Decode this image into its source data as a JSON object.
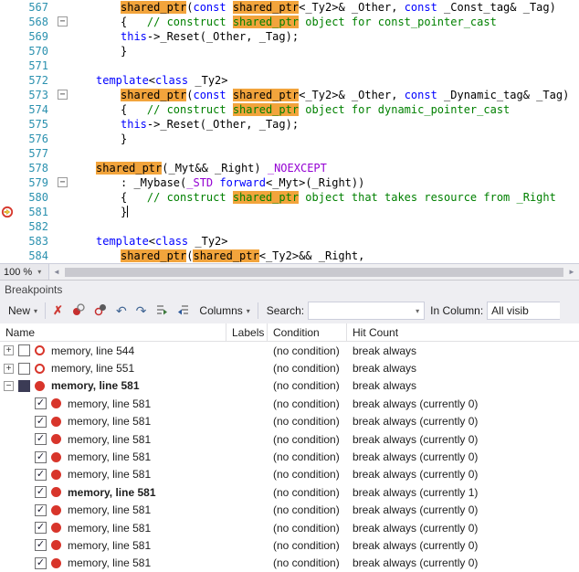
{
  "editor": {
    "zoom_label": "100 %",
    "lines": [
      {
        "num": 567,
        "ind": 2,
        "seg": [
          [
            "hl",
            "shared_ptr"
          ],
          [
            "p",
            "("
          ],
          [
            "k",
            "const"
          ],
          [
            "p",
            " "
          ],
          [
            "hl",
            "shared_ptr"
          ],
          [
            "p",
            "<_Ty2>& _Other, "
          ],
          [
            "k",
            "const"
          ],
          [
            "p",
            " _Const_tag& _Tag)"
          ]
        ]
      },
      {
        "num": 568,
        "ind": 2,
        "fold": true,
        "seg": [
          [
            "p",
            "{   "
          ],
          [
            "cm",
            "// construct "
          ],
          [
            "hlc",
            "shared_ptr"
          ],
          [
            "cm",
            " object for const_pointer_cast"
          ]
        ]
      },
      {
        "num": 569,
        "ind": 2,
        "seg": [
          [
            "k",
            "this"
          ],
          [
            "p",
            "->_Reset(_Other, _Tag);"
          ]
        ]
      },
      {
        "num": 570,
        "ind": 2,
        "seg": [
          [
            "p",
            "}"
          ]
        ]
      },
      {
        "num": 571,
        "ind": 0,
        "seg": []
      },
      {
        "num": 572,
        "ind": 1,
        "seg": [
          [
            "k",
            "template"
          ],
          [
            "p",
            "<"
          ],
          [
            "k",
            "class"
          ],
          [
            "p",
            " _Ty2>"
          ]
        ]
      },
      {
        "num": 573,
        "ind": 2,
        "fold": true,
        "seg": [
          [
            "hl",
            "shared_ptr"
          ],
          [
            "p",
            "("
          ],
          [
            "k",
            "const"
          ],
          [
            "p",
            " "
          ],
          [
            "hl",
            "shared_ptr"
          ],
          [
            "p",
            "<_Ty2>& _Other, "
          ],
          [
            "k",
            "const"
          ],
          [
            "p",
            " _Dynamic_tag& _Tag)"
          ]
        ]
      },
      {
        "num": 574,
        "ind": 2,
        "seg": [
          [
            "p",
            "{   "
          ],
          [
            "cm",
            "// construct "
          ],
          [
            "hlc",
            "shared_ptr"
          ],
          [
            "cm",
            " object for dynamic_pointer_cast"
          ]
        ]
      },
      {
        "num": 575,
        "ind": 2,
        "seg": [
          [
            "k",
            "this"
          ],
          [
            "p",
            "->_Reset(_Other, _Tag);"
          ]
        ]
      },
      {
        "num": 576,
        "ind": 2,
        "seg": [
          [
            "p",
            "}"
          ]
        ]
      },
      {
        "num": 577,
        "ind": 0,
        "seg": []
      },
      {
        "num": 578,
        "ind": 1,
        "seg": [
          [
            "hl",
            "shared_ptr"
          ],
          [
            "p",
            "(_Myt&& _Right) "
          ],
          [
            "m",
            "_NOEXCEPT"
          ]
        ]
      },
      {
        "num": 579,
        "ind": 2,
        "fold": true,
        "seg": [
          [
            "p",
            ": _Mybase("
          ],
          [
            "m",
            "_STD"
          ],
          [
            "p",
            " "
          ],
          [
            "k",
            "forward"
          ],
          [
            "p",
            "<_Myt>(_Right))"
          ]
        ]
      },
      {
        "num": 580,
        "ind": 2,
        "seg": [
          [
            "p",
            "{   "
          ],
          [
            "cm",
            "// construct "
          ],
          [
            "hlc",
            "shared_ptr"
          ],
          [
            "cm",
            " object that takes resource from _Right"
          ]
        ]
      },
      {
        "num": 581,
        "ind": 2,
        "glyph": "breakpoint-hit",
        "caret": true,
        "seg": [
          [
            "p",
            "}"
          ]
        ]
      },
      {
        "num": 582,
        "ind": 0,
        "seg": []
      },
      {
        "num": 583,
        "ind": 1,
        "seg": [
          [
            "k",
            "template"
          ],
          [
            "p",
            "<"
          ],
          [
            "k",
            "class"
          ],
          [
            "p",
            " _Ty2>"
          ]
        ]
      },
      {
        "num": 584,
        "ind": 2,
        "seg": [
          [
            "hl",
            "shared_ptr"
          ],
          [
            "p",
            "("
          ],
          [
            "hl",
            "shared_ptr"
          ],
          [
            "p",
            "<_Ty2>&& _Right,"
          ]
        ]
      }
    ]
  },
  "panel": {
    "title": "Breakpoints",
    "toolbar": {
      "new_label": "New",
      "columns_label": "Columns",
      "search_label": "Search:",
      "search_value": "",
      "in_column_label": "In Column:",
      "in_column_value": "All visib"
    },
    "columns": [
      "Name",
      "Labels",
      "Condition",
      "Hit Count"
    ],
    "rows": [
      {
        "lvl": 0,
        "exp": "plus",
        "chk": "off",
        "bp": "hollow",
        "bold": false,
        "name": "memory, line 544",
        "labels": "",
        "cond": "(no condition)",
        "hit": "break always"
      },
      {
        "lvl": 0,
        "exp": "plus",
        "chk": "off",
        "bp": "hollow",
        "bold": false,
        "name": "memory, line 551",
        "labels": "",
        "cond": "(no condition)",
        "hit": "break always"
      },
      {
        "lvl": 0,
        "exp": "minus",
        "chk": "filled",
        "bp": "solid",
        "bold": true,
        "name": "memory, line 581",
        "labels": "",
        "cond": "(no condition)",
        "hit": "break always"
      },
      {
        "lvl": 1,
        "chk": "check",
        "bp": "solid",
        "bold": false,
        "name": "memory, line 581",
        "labels": "",
        "cond": "(no condition)",
        "hit": "break always (currently 0)"
      },
      {
        "lvl": 1,
        "chk": "check",
        "bp": "solid",
        "bold": false,
        "name": "memory, line 581",
        "labels": "",
        "cond": "(no condition)",
        "hit": "break always (currently 0)"
      },
      {
        "lvl": 1,
        "chk": "check",
        "bp": "solid",
        "bold": false,
        "name": "memory, line 581",
        "labels": "",
        "cond": "(no condition)",
        "hit": "break always (currently 0)"
      },
      {
        "lvl": 1,
        "chk": "check",
        "bp": "solid",
        "bold": false,
        "name": "memory, line 581",
        "labels": "",
        "cond": "(no condition)",
        "hit": "break always (currently 0)"
      },
      {
        "lvl": 1,
        "chk": "check",
        "bp": "solid",
        "bold": false,
        "name": "memory, line 581",
        "labels": "",
        "cond": "(no condition)",
        "hit": "break always (currently 0)"
      },
      {
        "lvl": 1,
        "chk": "check",
        "bp": "solid",
        "bold": true,
        "name": "memory, line 581",
        "labels": "",
        "cond": "(no condition)",
        "hit": "break always (currently 1)"
      },
      {
        "lvl": 1,
        "chk": "check",
        "bp": "solid",
        "bold": false,
        "name": "memory, line 581",
        "labels": "",
        "cond": "(no condition)",
        "hit": "break always (currently 0)"
      },
      {
        "lvl": 1,
        "chk": "check",
        "bp": "solid",
        "bold": false,
        "name": "memory, line 581",
        "labels": "",
        "cond": "(no condition)",
        "hit": "break always (currently 0)"
      },
      {
        "lvl": 1,
        "chk": "check",
        "bp": "solid",
        "bold": false,
        "name": "memory, line 581",
        "labels": "",
        "cond": "(no condition)",
        "hit": "break always (currently 0)"
      },
      {
        "lvl": 1,
        "chk": "check",
        "bp": "solid",
        "bold": false,
        "name": "memory, line 581",
        "labels": "",
        "cond": "(no condition)",
        "hit": "break always (currently 0)"
      }
    ]
  },
  "icons": {
    "chevron_down": "▾",
    "delete": "✗",
    "go_to_source": "↶",
    "go_to_disassembly": "↷",
    "scroll_left": "◄",
    "scroll_right": "►",
    "plus": "+",
    "minus": "−",
    "check": "✓"
  },
  "colors": {
    "highlight_orange": "#F2A43C",
    "keyword_blue": "#0000FF",
    "comment_green": "#008000",
    "macro_purple": "#9400D3",
    "line_number_teal": "#2B91AF",
    "breakpoint_red": "#D8352B"
  }
}
